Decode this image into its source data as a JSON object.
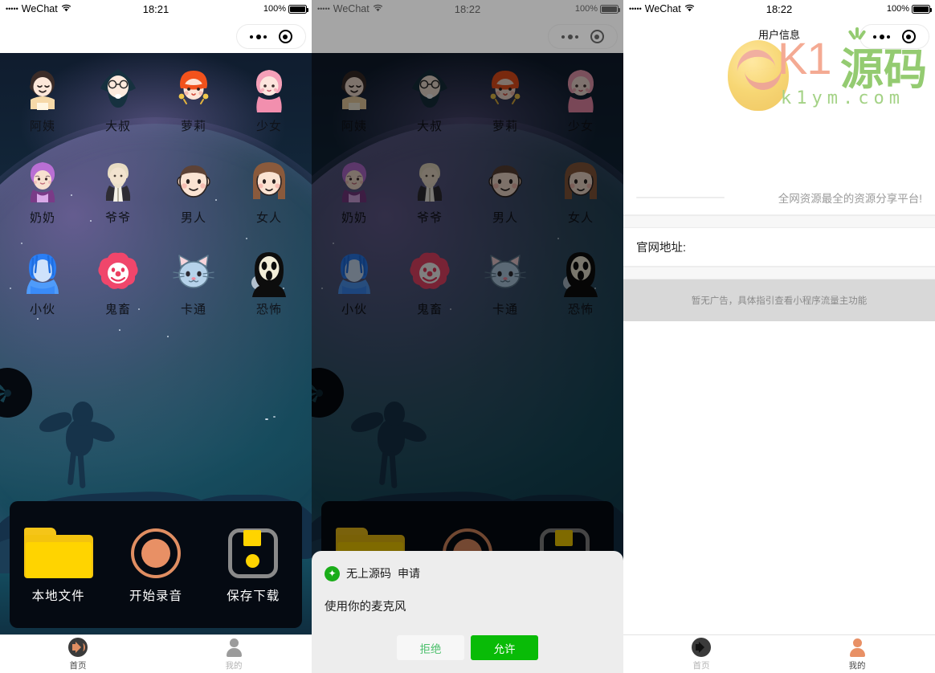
{
  "panels": [
    {
      "id": "voice-changer-home",
      "status": {
        "carrier": "WeChat",
        "dots": "•••••",
        "time": "18:21",
        "battery_pct": "100%"
      },
      "nav": {
        "title": ""
      },
      "grid": [
        {
          "label": "阿姨",
          "icon": "auntie-avatar-icon"
        },
        {
          "label": "大叔",
          "icon": "uncle-avatar-icon"
        },
        {
          "label": "萝莉",
          "icon": "loli-avatar-icon"
        },
        {
          "label": "少女",
          "icon": "girl-avatar-icon"
        },
        {
          "label": "奶奶",
          "icon": "grandma-avatar-icon"
        },
        {
          "label": "爷爷",
          "icon": "grandpa-avatar-icon"
        },
        {
          "label": "男人",
          "icon": "man-avatar-icon"
        },
        {
          "label": "女人",
          "icon": "woman-avatar-icon"
        },
        {
          "label": "小伙",
          "icon": "young-man-avatar-icon"
        },
        {
          "label": "鬼畜",
          "icon": "clown-avatar-icon"
        },
        {
          "label": "卡通",
          "icon": "cat-avatar-icon"
        },
        {
          "label": "恐怖",
          "icon": "horror-avatar-icon"
        }
      ],
      "actions": [
        {
          "label": "本地文件",
          "icon": "folder-icon"
        },
        {
          "label": "开始录音",
          "icon": "record-icon"
        },
        {
          "label": "保存下载",
          "icon": "save-download-icon"
        }
      ],
      "tabbar": [
        {
          "label": "首页",
          "icon": "speaker-icon",
          "active": true
        },
        {
          "label": "我的",
          "icon": "person-icon",
          "active": false
        }
      ]
    },
    {
      "id": "voice-changer-permission",
      "status": {
        "carrier": "WeChat",
        "dots": "•••••",
        "time": "18:22",
        "battery_pct": "100%"
      },
      "dialog": {
        "badge": "✦",
        "app_name": "无上源码",
        "action_word": "申请",
        "message": "使用你的麦克风",
        "deny_label": "拒绝",
        "allow_label": "允许",
        "allow_color": "#09bb07",
        "deny_color": "#4bbf6b"
      }
    },
    {
      "id": "user-info",
      "status": {
        "carrier": "WeChat",
        "dots": "•••••",
        "time": "18:22",
        "battery_pct": "100%"
      },
      "nav": {
        "title": "用户信息"
      },
      "watermark": {
        "brand": "K1",
        "brand_cn": "源码",
        "domain": "k1ym.com"
      },
      "rows": [
        {
          "label": "",
          "value": "全网资源最全的资源分享平台!"
        },
        {
          "label": "官网地址:",
          "value": ""
        }
      ],
      "ad_placeholder": "暂无广告，具体指引查看小程序流量主功能",
      "tabbar": [
        {
          "label": "首页",
          "icon": "speaker-icon",
          "active": false
        },
        {
          "label": "我的",
          "icon": "person-icon",
          "active": true
        }
      ]
    }
  ]
}
